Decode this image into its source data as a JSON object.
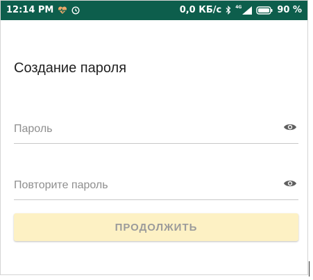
{
  "status_bar": {
    "time": "12:14 PM",
    "network_speed": "0,0 КБ/с",
    "network_type": "4G",
    "battery": "90 %"
  },
  "screen": {
    "title": "Создание пароля"
  },
  "form": {
    "password_placeholder": "Пароль",
    "repeat_placeholder": "Повторите пароль",
    "continue_label": "ПРОДОЛЖИТЬ"
  },
  "colors": {
    "status_bar_bg": "#0d5e4c",
    "button_bg": "#fdf1c4",
    "button_text": "#9b9b9b"
  },
  "icons": {
    "status_left": [
      "heart-rate-icon",
      "alarm-icon"
    ],
    "status_right": [
      "bluetooth-icon",
      "signal-icon",
      "battery-icon"
    ],
    "field_action": "eye-icon"
  }
}
